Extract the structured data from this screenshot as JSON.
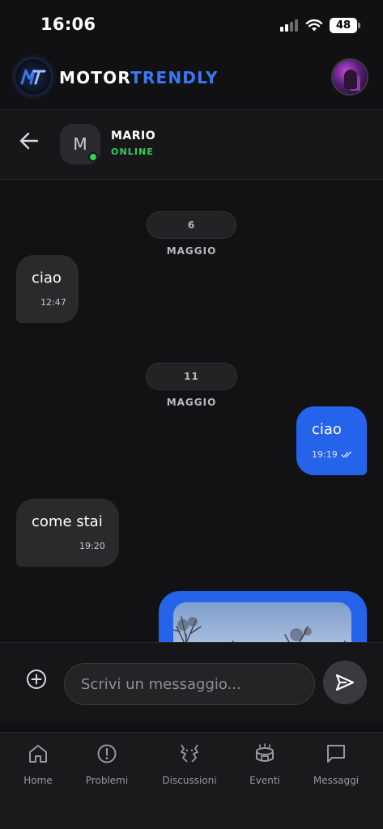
{
  "status_bar": {
    "time": "16:06",
    "battery": "48"
  },
  "app_header": {
    "brand_part1": "MOTOR",
    "brand_part2": "TRENDLY",
    "logo_text": "MT",
    "brand_accent_color": "#3a78f2"
  },
  "chat_header": {
    "avatar_initial": "M",
    "contact_name": "MARIO",
    "contact_status": "ONLINE",
    "status_color": "#2fd05c"
  },
  "messages": {
    "date_1": "6 MAGGIO",
    "msg_1_text": "ciao",
    "msg_1_time": "12:47",
    "date_2": "11 MAGGIO",
    "msg_2_text": "ciao",
    "msg_2_time": "19:19",
    "msg_3_text": "come stai",
    "msg_3_time": "19:20"
  },
  "composer": {
    "placeholder": "Scrivi un messaggio...",
    "value": ""
  },
  "tab_bar": {
    "home": "Home",
    "problems": "Problemi",
    "discussions": "Discussioni",
    "events": "Eventi",
    "messages": "Messaggi"
  },
  "colors": {
    "outgoing_bubble": "#2563eb",
    "incoming_bubble": "#2a2a2d",
    "background": "#121214"
  }
}
